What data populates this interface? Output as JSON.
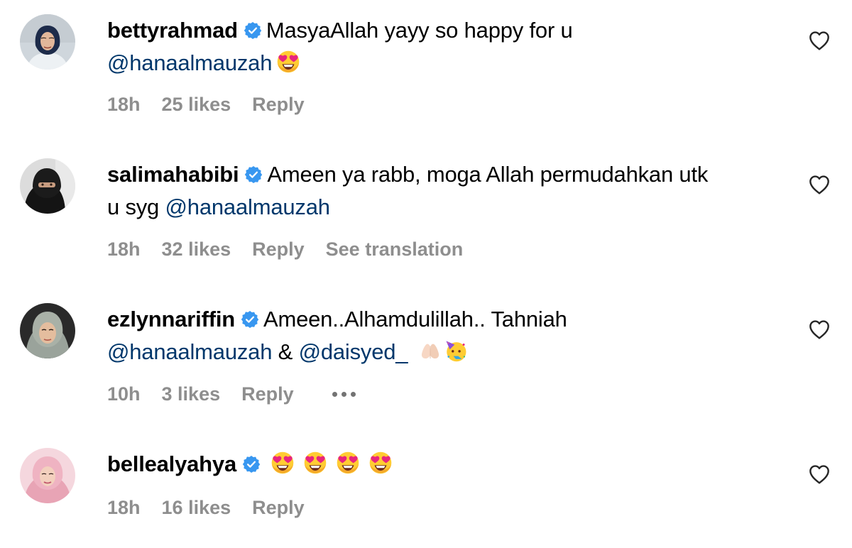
{
  "colors": {
    "verified": "#3897f0",
    "mention": "#00376b",
    "meta": "#8e8e8e",
    "heart_stroke": "#262626"
  },
  "comments": [
    {
      "username": "bettyrahmad",
      "verified_icon": "verified-badge-icon",
      "text_line1": "MasyaAllah yayy so happy for u",
      "mention": "@hanaalmauzah",
      "emoji": "heart-eyes-emoji",
      "time": "18h",
      "likes": "25 likes",
      "reply": "Reply"
    },
    {
      "username": "salimahabibi",
      "verified_icon": "verified-badge-icon",
      "text_line1": "Ameen ya rabb, moga Allah permudahkan utk",
      "text_line2_prefix": "u syg",
      "mention": "@hanaalmauzah",
      "time": "18h",
      "likes": "32 likes",
      "reply": "Reply",
      "translate": "See translation"
    },
    {
      "username": "ezlynnariffin",
      "verified_icon": "verified-badge-icon",
      "text_line1": "Ameen..Alhamdulillah.. Tahniah",
      "mention": "@hanaalmauzah",
      "joiner": "&",
      "mention2": "@daisyed_",
      "emojis": [
        "folded-hands-emoji",
        "partying-face-emoji"
      ],
      "time": "10h",
      "likes": "3 likes",
      "reply": "Reply",
      "more_icon": "more-options-icon"
    },
    {
      "username": "bellealyahya",
      "verified_icon": "verified-badge-icon",
      "emojis": [
        "heart-eyes-emoji",
        "heart-eyes-emoji",
        "heart-eyes-emoji",
        "heart-eyes-emoji"
      ],
      "time": "18h",
      "likes": "16 likes",
      "reply": "Reply"
    }
  ]
}
